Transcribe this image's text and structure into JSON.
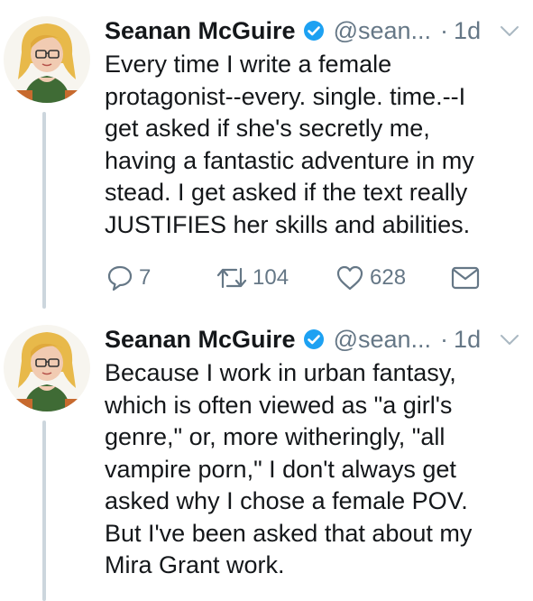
{
  "tweets": [
    {
      "author_name": "Seanan McGuire",
      "handle": "@sean...",
      "separator": "·",
      "time": "1d",
      "text": "Every time I write a female\nprotagonist--every. single. time.--I\nget asked if she's secretly me,\nhaving a fantastic adventure in my\nstead. I get asked if the text really\nJUSTIFIES her skills and abilities.",
      "replies": "7",
      "retweets": "104",
      "likes": "628"
    },
    {
      "author_name": "Seanan McGuire",
      "handle": "@sean...",
      "separator": "·",
      "time": "1d",
      "text": "Because I work in urban fantasy,\nwhich is often viewed as \"a girl's\ngenre,\" or, more witheringly, \"all\nvampire porn,\" I don't always get\nasked why I chose a female POV.\nBut I've been asked that about my\nMira Grant work."
    }
  ],
  "icons": {
    "verified": "verified-badge-icon",
    "chevron": "chevron-down-icon",
    "reply": "reply-icon",
    "retweet": "retweet-icon",
    "like": "heart-icon",
    "dm": "envelope-icon"
  },
  "colors": {
    "text": "#14171a",
    "secondary": "#657786",
    "verified": "#1da1f2",
    "thread_line": "#ccd6dd"
  }
}
